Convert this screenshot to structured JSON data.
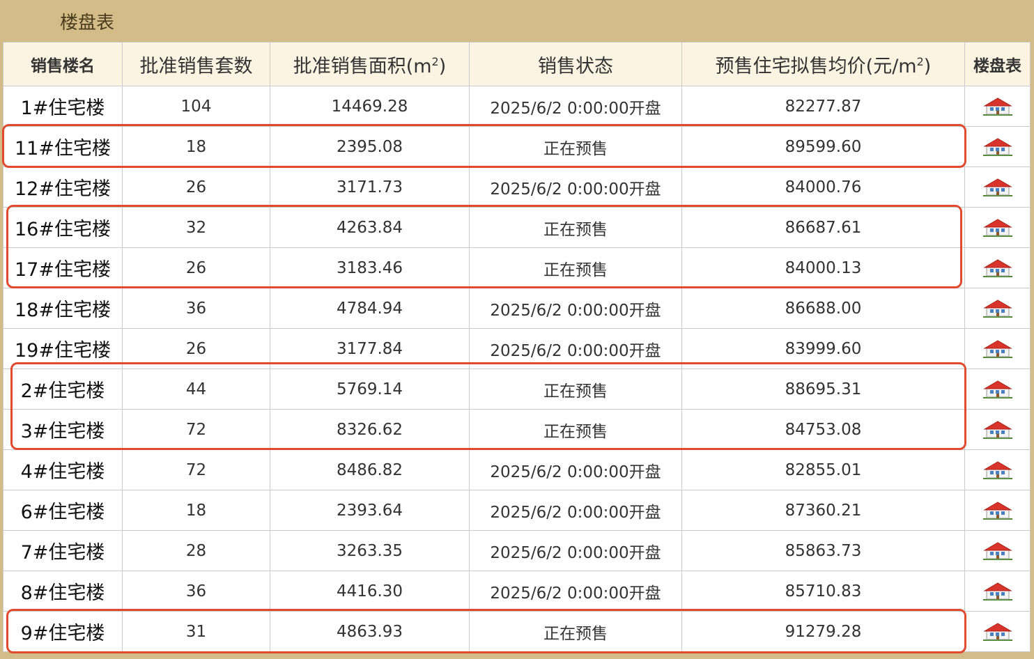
{
  "panel": {
    "title": "楼盘表"
  },
  "table": {
    "headers": {
      "name": "销售楼名",
      "units": "批准销售套数",
      "area_prefix": "批准销售面积(m",
      "area_sup": "2",
      "area_suffix": ")",
      "status": "销售状态",
      "price_prefix": "预售住宅拟售均价(元/m",
      "price_sup": "2",
      "price_suffix": ")",
      "floorplan": "楼盘表"
    },
    "rows": [
      {
        "name": "1#住宅楼",
        "units": "104",
        "area": "14469.28",
        "status": "2025/6/2 0:00:00开盘",
        "price": "82277.87"
      },
      {
        "name": "11#住宅楼",
        "units": "18",
        "area": "2395.08",
        "status": "正在预售",
        "price": "89599.60"
      },
      {
        "name": "12#住宅楼",
        "units": "26",
        "area": "3171.73",
        "status": "2025/6/2 0:00:00开盘",
        "price": "84000.76"
      },
      {
        "name": "16#住宅楼",
        "units": "32",
        "area": "4263.84",
        "status": "正在预售",
        "price": "86687.61"
      },
      {
        "name": "17#住宅楼",
        "units": "26",
        "area": "3183.46",
        "status": "正在预售",
        "price": "84000.13"
      },
      {
        "name": "18#住宅楼",
        "units": "36",
        "area": "4784.94",
        "status": "2025/6/2 0:00:00开盘",
        "price": "86688.00"
      },
      {
        "name": "19#住宅楼",
        "units": "26",
        "area": "3177.84",
        "status": "2025/6/2 0:00:00开盘",
        "price": "83999.60"
      },
      {
        "name": "2#住宅楼",
        "units": "44",
        "area": "5769.14",
        "status": "正在预售",
        "price": "88695.31"
      },
      {
        "name": "3#住宅楼",
        "units": "72",
        "area": "8326.62",
        "status": "正在预售",
        "price": "84753.08"
      },
      {
        "name": "4#住宅楼",
        "units": "72",
        "area": "8486.82",
        "status": "2025/6/2 0:00:00开盘",
        "price": "82855.01"
      },
      {
        "name": "6#住宅楼",
        "units": "18",
        "area": "2393.64",
        "status": "2025/6/2 0:00:00开盘",
        "price": "87360.21"
      },
      {
        "name": "7#住宅楼",
        "units": "28",
        "area": "3263.35",
        "status": "2025/6/2 0:00:00开盘",
        "price": "85863.73"
      },
      {
        "name": "8#住宅楼",
        "units": "36",
        "area": "4416.30",
        "status": "2025/6/2 0:00:00开盘",
        "price": "85710.83"
      },
      {
        "name": "9#住宅楼",
        "units": "31",
        "area": "4863.93",
        "status": "正在预售",
        "price": "91279.28"
      }
    ],
    "row_icon": "house-icon"
  },
  "colors": {
    "panel_bg": "#d3bc88",
    "header_bg": "#fbf4e3",
    "highlight_border": "#e04a2f"
  }
}
